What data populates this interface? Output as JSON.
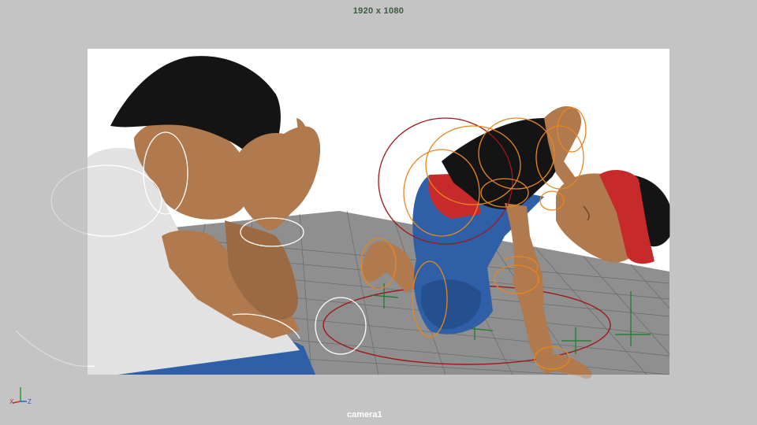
{
  "viewport": {
    "resolution_gate_label": "1920 x 1080",
    "camera_label": "camera1",
    "axis_labels": {
      "x": "X",
      "y": "Y",
      "z": "Z"
    },
    "colors": {
      "outside_gate": "#c4c4c4",
      "backdrop": "#ffffff",
      "floor": "#8e8e8e",
      "grid_lines": "#5f5f5f",
      "skin": "#b07a4e",
      "hair_shirt": "#141414",
      "jeans": "#2f5fa6",
      "headband": "#c62a2a",
      "control_orange": "#e8861e",
      "control_red": "#a01818",
      "control_white": "#ffffff",
      "grid_green": "#1a7a2a"
    }
  }
}
